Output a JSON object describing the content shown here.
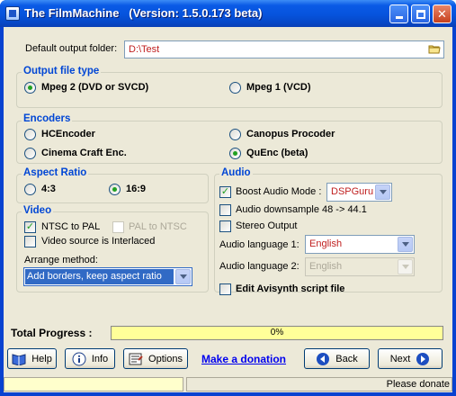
{
  "window": {
    "title": "The FilmMachine   (Version: 1.5.0.173 beta)",
    "minimize_label": "_",
    "maximize_label": "□",
    "close_label": "✕"
  },
  "output": {
    "folder_label": "Default output folder:",
    "folder_value": "D:\\Test"
  },
  "file_type": {
    "title": "Output file type",
    "options": [
      "Mpeg 2 (DVD or SVCD)",
      "Mpeg 1 (VCD)"
    ],
    "selected": "Mpeg 2 (DVD or SVCD)"
  },
  "encoders": {
    "title": "Encoders",
    "options": [
      "HCEncoder",
      "Canopus Procoder",
      "Cinema Craft Enc.",
      "QuEnc (beta)"
    ],
    "selected": "QuEnc (beta)"
  },
  "aspect": {
    "title": "Aspect Ratio",
    "options": [
      "4:3",
      "16:9"
    ],
    "selected": "16:9"
  },
  "video": {
    "title": "Video",
    "ntsc_to_pal": "NTSC to PAL",
    "pal_to_ntsc": "PAL to NTSC",
    "interlaced": "Video source is Interlaced",
    "arrange_label": "Arrange method:",
    "arrange_value": "Add borders, keep aspect ratio"
  },
  "audio": {
    "title": "Audio",
    "boost_label": "Boost Audio Mode :",
    "boost_value": "DSPGuru",
    "downsample_label": "Audio downsample 48 -> 44.1",
    "stereo_label": "Stereo Output",
    "lang1_label": "Audio language 1:",
    "lang1_value": "English",
    "lang2_label": "Audio language 2:",
    "lang2_value": "English"
  },
  "avisynth": {
    "label": "Edit Avisynth script file"
  },
  "progress": {
    "label": "Total Progress :",
    "value_text": "0%",
    "value": 0
  },
  "buttons": {
    "help": "Help",
    "info": "Info",
    "options": "Options",
    "donate": "Make a donation",
    "back": "Back",
    "next": "Next"
  },
  "status": {
    "text": "Please donate"
  }
}
